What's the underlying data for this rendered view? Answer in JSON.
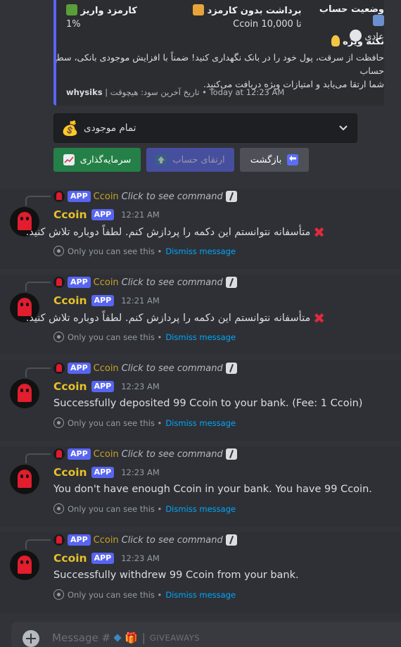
{
  "embed": {
    "fields": [
      {
        "name": "کارمزد واریز",
        "value": "1%",
        "emoji": "money-wings-emoji"
      },
      {
        "name": "برداشت بدون کارمزد",
        "value": "تا 10,000 Ccoin",
        "emoji": "flexed-arm-emoji"
      },
      {
        "name": "وضعیت حساب",
        "value": "عادی",
        "emoji": "bar-chart-emoji"
      }
    ],
    "tip_title": "نکته ویژه",
    "tip_text_line1": "حافظت از سرقت، پول خود را در بانک نگهداری کنید! ضمناً با افزایش موجودی بانکی، سطح حساب",
    "tip_text_line2": "شما ارتقا می‌یابد و امتیازات ویژه دریافت می‌کنید.",
    "footer_user": "whysiks",
    "footer_middle": "| تاریخ آخرین سود: هیچوقت",
    "footer_time": "• Today at 12:23 AM"
  },
  "select": {
    "label": "تمام موجودی"
  },
  "buttons": {
    "invest": "سرمایه‌گذاری",
    "upgrade": "ارتقای حساب",
    "back": "بازگشت"
  },
  "messages": [
    {
      "reply_tag": "APP",
      "reply_name": "Ccoin",
      "reply_cmd": "Click to see command",
      "author": "Ccoin",
      "tag": "APP",
      "time": "12:21 AM",
      "text": "متأسفانه نتوانستم این دکمه را پردازش کنم. لطفاً دوباره تلاش کنید.",
      "error": true,
      "eph_text": "Only you can see this •",
      "dismiss": "Dismiss message"
    },
    {
      "reply_tag": "APP",
      "reply_name": "Ccoin",
      "reply_cmd": "Click to see command",
      "author": "Ccoin",
      "tag": "APP",
      "time": "12:21 AM",
      "text": "متأسفانه نتوانستم این دکمه را پردازش کنم. لطفاً دوباره تلاش کنید.",
      "error": true,
      "eph_text": "Only you can see this •",
      "dismiss": "Dismiss message"
    },
    {
      "reply_tag": "APP",
      "reply_name": "Ccoin",
      "reply_cmd": "Click to see command",
      "author": "Ccoin",
      "tag": "APP",
      "time": "12:23 AM",
      "text": "Successfully deposited 99 Ccoin to your bank. (Fee: 1 Ccoin)",
      "error": false,
      "eph_text": "Only you can see this •",
      "dismiss": "Dismiss message"
    },
    {
      "reply_tag": "APP",
      "reply_name": "Ccoin",
      "reply_cmd": "Click to see command",
      "author": "Ccoin",
      "tag": "APP",
      "time": "12:23 AM",
      "text": "You don't have enough Ccoin in your bank. You have 99 Ccoin.",
      "error": false,
      "eph_text": "Only you can see this •",
      "dismiss": "Dismiss message"
    },
    {
      "reply_tag": "APP",
      "reply_name": "Ccoin",
      "reply_cmd": "Click to see command",
      "author": "Ccoin",
      "tag": "APP",
      "time": "12:23 AM",
      "text": "Successfully withdrew 99 Ccoin from your bank.",
      "error": false,
      "eph_text": "Only you can see this •",
      "dismiss": "Dismiss message"
    }
  ],
  "composer": {
    "placeholder": "Message #",
    "channel_suffix": "GIVEAWAYS"
  },
  "colors": {
    "background": "#313338",
    "embed_bar": "#5865f2",
    "author": "#e7c12a",
    "dismiss_link": "#00a8fc",
    "error_x": "#e0293f",
    "invest_button": "#248046"
  }
}
